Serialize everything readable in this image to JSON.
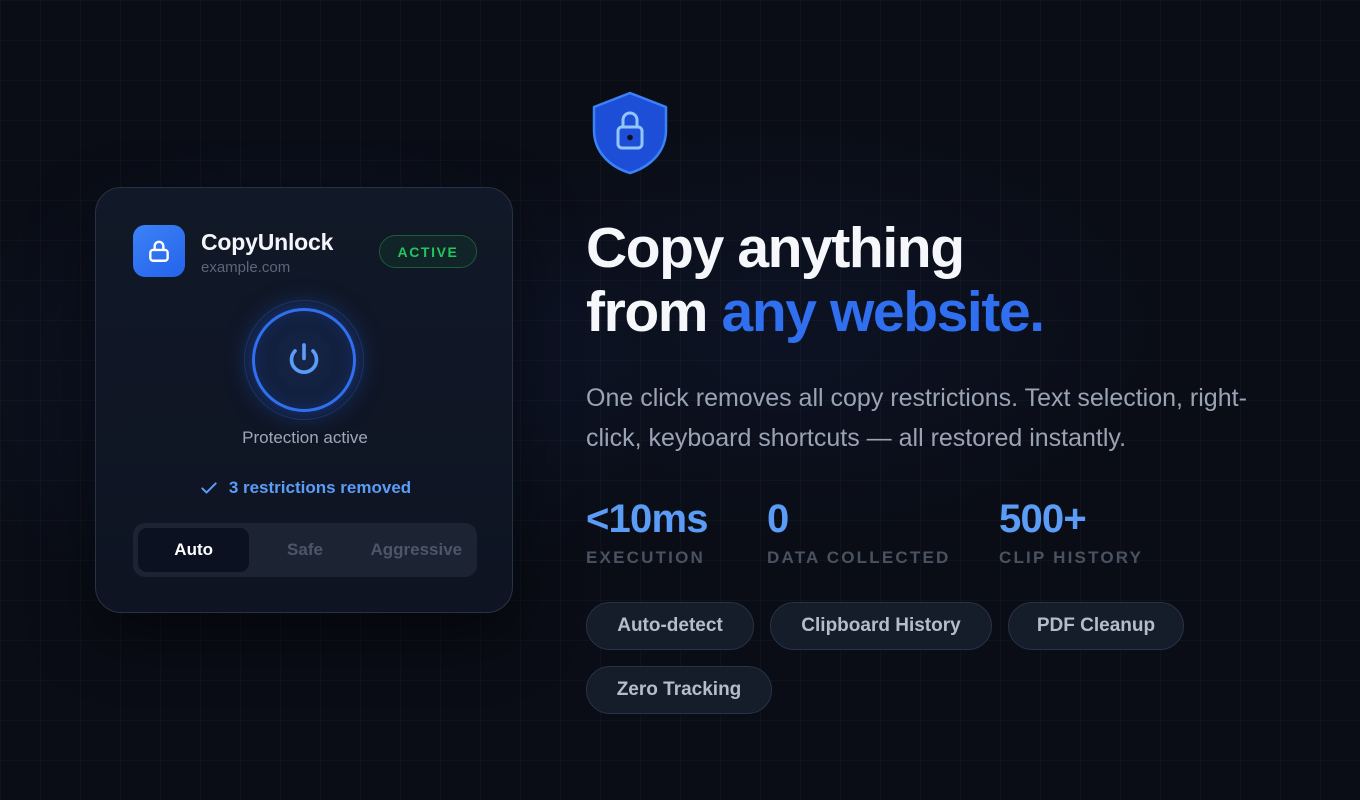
{
  "app": {
    "name": "CopyUnlock",
    "domain": "example.com",
    "status_badge": "ACTIVE",
    "power_status": "Protection active",
    "restrictions_text": "3 restrictions removed",
    "modes": [
      "Auto",
      "Safe",
      "Aggressive"
    ],
    "selected_mode": "Auto"
  },
  "hero": {
    "headline_line1": "Copy anything",
    "headline_line2_prefix": "from ",
    "headline_line2_accent": "any website.",
    "subtext": "One click removes all copy restrictions. Text selection, right-click, keyboard shortcuts — all restored instantly."
  },
  "stats": [
    {
      "value": "<10ms",
      "label": "EXECUTION"
    },
    {
      "value": "0",
      "label": "DATA COLLECTED"
    },
    {
      "value": "500+",
      "label": "CLIP HISTORY"
    }
  ],
  "features": [
    "Auto-detect",
    "Clipboard History",
    "PDF Cleanup",
    "Zero Tracking"
  ],
  "icons": {
    "app": "lock-icon",
    "power": "power-icon",
    "check": "check-icon",
    "hero": "shield-lock-icon"
  },
  "colors": {
    "accent": "#2f6ff0",
    "accent_light": "#5b9cf6",
    "success": "#22c55e",
    "background": "#0a0d16"
  }
}
